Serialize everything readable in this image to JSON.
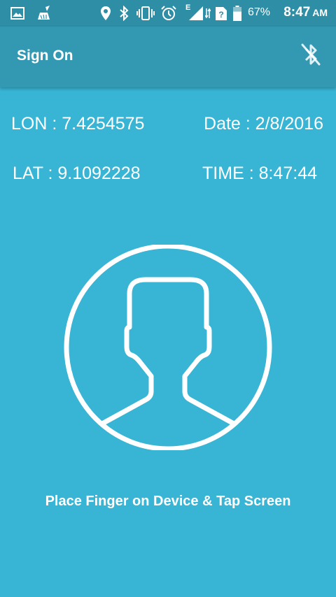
{
  "status_bar": {
    "battery_percent": "67%",
    "time": "8:47",
    "ampm": "AM",
    "network_type": "E",
    "icons": [
      "image-icon",
      "cleaner-icon",
      "location-icon",
      "bluetooth-icon",
      "vibrate-icon",
      "alarm-icon",
      "signal-icon",
      "sim-icon",
      "battery-icon"
    ]
  },
  "toolbar": {
    "title": "Sign On",
    "action_icon": "bluetooth-disabled-icon"
  },
  "info": {
    "lon": "LON : 7.4254575",
    "date": "Date : 2/8/2016",
    "lat": "LAT : 9.1092228",
    "time": "TIME : 8:47:44"
  },
  "avatar_icon": "user-avatar-icon",
  "instruction": "Place Finger on Device & Tap Screen",
  "colors": {
    "background": "#38b4d4",
    "toolbar": "#3399b3",
    "status_bar": "#2e8ea6",
    "foreground": "#ffffff"
  }
}
